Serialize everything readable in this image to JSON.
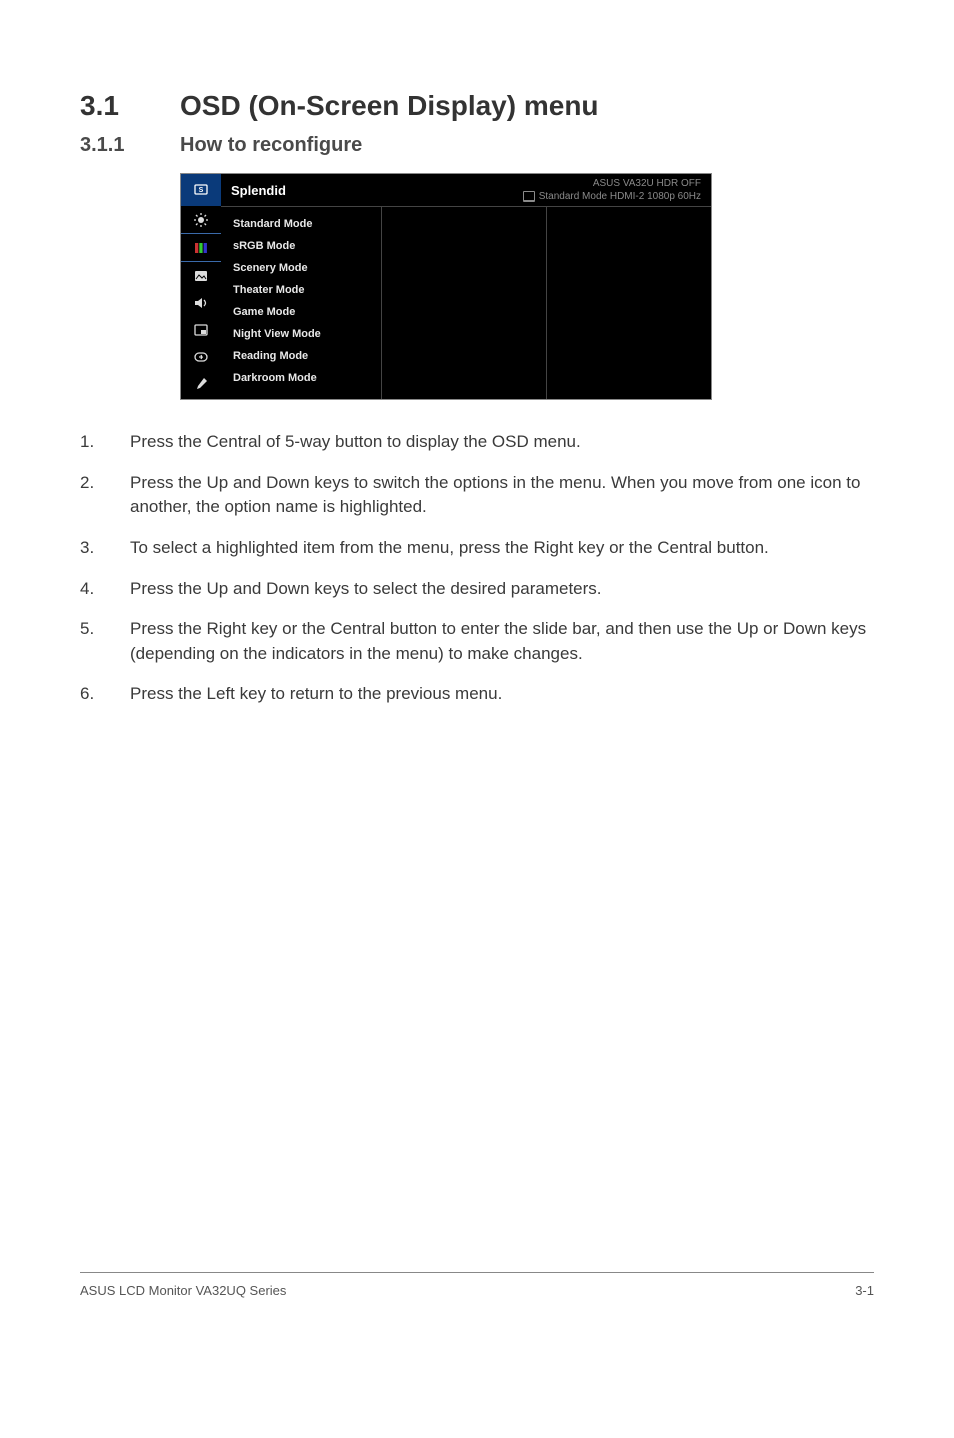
{
  "headings": {
    "h1_num": "3.1",
    "h1_title": "OSD (On-Screen Display) menu",
    "h2_num": "3.1.1",
    "h2_title": "How to reconfigure"
  },
  "osd": {
    "title": "Splendid",
    "brand_line": "ASUS  VA32U HDR OFF",
    "status_line": "Standard Mode  HDMI-2  1080p  60Hz",
    "modes": [
      "Standard Mode",
      "sRGB Mode",
      "Scenery Mode",
      "Theater Mode",
      "Game Mode",
      "Night View Mode",
      "Reading Mode",
      "Darkroom Mode"
    ]
  },
  "instructions": [
    {
      "n": "1.",
      "t": "Press the Central of 5-way button to display the OSD menu."
    },
    {
      "n": "2.",
      "t": "Press the Up and Down keys to switch the options in the menu. When you move from one icon to another, the option name is highlighted."
    },
    {
      "n": "3.",
      "t": "To select a highlighted item from the menu, press the Right key or the Central button."
    },
    {
      "n": "4.",
      "t": "Press the Up and Down keys to select the desired parameters."
    },
    {
      "n": "5.",
      "t": "Press the Right key or the Central button to enter the slide bar, and then use the Up or Down keys (depending on the indicators in the menu) to make changes."
    },
    {
      "n": "6.",
      "t": "Press the Left key to return to the previous menu."
    }
  ],
  "footer": {
    "left": "ASUS LCD Monitor VA32UQ Series",
    "right": "3-1"
  }
}
